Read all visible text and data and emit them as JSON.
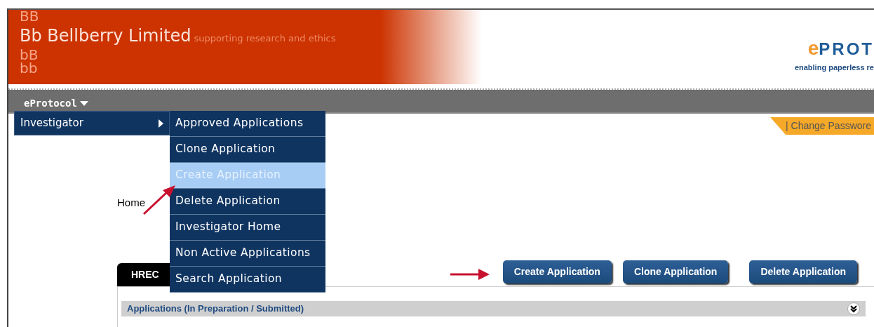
{
  "banner": {
    "faded_letters": [
      "BB",
      "bB",
      "bb"
    ],
    "title": "Bb Bellberry Limited",
    "tagline": "supporting research and ethics"
  },
  "logo": {
    "mark": "e",
    "name": "PROT",
    "tagline": "enabling paperless re"
  },
  "nav": {
    "label": "eProtocol"
  },
  "menu": [
    {
      "label": "Investigator",
      "expanded": true,
      "children": [
        {
          "label": "Approved Applications",
          "selected": false
        },
        {
          "label": "Clone Application",
          "selected": false
        },
        {
          "label": "Create Application",
          "selected": true
        },
        {
          "label": "Delete Application",
          "selected": false
        },
        {
          "label": "Investigator Home",
          "selected": false
        },
        {
          "label": "Non Active Applications",
          "selected": false
        },
        {
          "label": "Search Application",
          "selected": false
        }
      ]
    }
  ],
  "change_password": "| Change Passwore",
  "breadcrumb": "Home",
  "tab": "HREC",
  "buttons": [
    "Create Application",
    "Clone Application",
    "Delete Application"
  ],
  "panel": {
    "title": "Applications (In Preparation / Submitted)",
    "expanded": false
  }
}
